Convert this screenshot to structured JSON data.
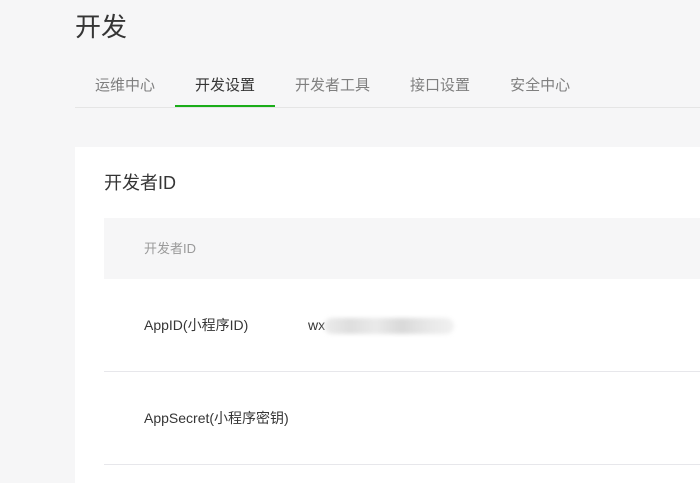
{
  "page": {
    "title": "开发"
  },
  "tabs": [
    {
      "label": "运维中心",
      "active": false
    },
    {
      "label": "开发设置",
      "active": true
    },
    {
      "label": "开发者工具",
      "active": false
    },
    {
      "label": "接口设置",
      "active": false
    },
    {
      "label": "安全中心",
      "active": false
    }
  ],
  "section": {
    "title": "开发者ID",
    "table_header": "开发者ID",
    "rows": [
      {
        "label": "AppID(小程序ID)",
        "value": "wx"
      },
      {
        "label": "AppSecret(小程序密钥)",
        "value": ""
      }
    ]
  },
  "colors": {
    "accent": "#1aad19",
    "page_bg": "#f6f6f7",
    "card_bg": "#ffffff"
  }
}
